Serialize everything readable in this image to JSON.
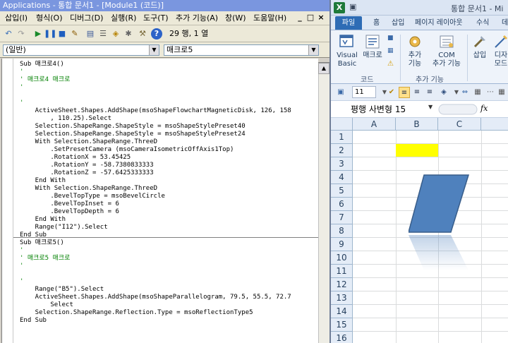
{
  "vba": {
    "title": "Applications - 통합 문서1 - [Module1 (코드)]",
    "menu": [
      {
        "label": "삽입(I)"
      },
      {
        "label": "형식(O)"
      },
      {
        "label": "디버그(D)"
      },
      {
        "label": "실행(R)"
      },
      {
        "label": "도구(T)"
      },
      {
        "label": "추가 기능(A)"
      },
      {
        "label": "창(W)"
      },
      {
        "label": "도움말(H)"
      }
    ],
    "window_controls": {
      "min": "_",
      "restore": "□",
      "close": "×"
    },
    "position": "29 행, 1 열",
    "object_combo": "(일반)",
    "proc_combo": "매크로5",
    "code_lines": [
      {
        "text": "Sub 매크로4()",
        "type": "code"
      },
      {
        "text": "'",
        "type": "comment"
      },
      {
        "text": "' 매크로4 매크로",
        "type": "comment"
      },
      {
        "text": "'",
        "type": "comment"
      },
      {
        "text": "",
        "type": "code"
      },
      {
        "text": "'",
        "type": "comment"
      },
      {
        "text": "    ActiveSheet.Shapes.AddShape(msoShapeFlowchartMagneticDisk, 126, 158",
        "type": "code"
      },
      {
        "text": "        , 110.25).Select",
        "type": "code"
      },
      {
        "text": "    Selection.ShapeRange.ShapeStyle = msoShapeStylePreset40",
        "type": "code"
      },
      {
        "text": "    Selection.ShapeRange.ShapeStyle = msoShapeStylePreset24",
        "type": "code"
      },
      {
        "text": "    With Selection.ShapeRange.ThreeD",
        "type": "code"
      },
      {
        "text": "        .SetPresetCamera (msoCameraIsometricOffAxis1Top)",
        "type": "code"
      },
      {
        "text": "        .RotationX = 53.45425",
        "type": "code"
      },
      {
        "text": "        .RotationY = -58.7380833333",
        "type": "code"
      },
      {
        "text": "        .RotationZ = -57.6425333333",
        "type": "code"
      },
      {
        "text": "    End With",
        "type": "code"
      },
      {
        "text": "    With Selection.ShapeRange.ThreeD",
        "type": "code"
      },
      {
        "text": "        .BevelTopType = msoBevelCircle",
        "type": "code"
      },
      {
        "text": "        .BevelTopInset = 6",
        "type": "code"
      },
      {
        "text": "        .BevelTopDepth = 6",
        "type": "code"
      },
      {
        "text": "    End With",
        "type": "code"
      },
      {
        "text": "    Range(\"I12\").Select",
        "type": "code"
      },
      {
        "text": "End Sub",
        "type": "code"
      },
      {
        "text": "Sub 매크로5()",
        "type": "code"
      },
      {
        "text": "'",
        "type": "comment"
      },
      {
        "text": "' 매크로5 매크로",
        "type": "comment"
      },
      {
        "text": "'",
        "type": "comment"
      },
      {
        "text": "",
        "type": "code"
      },
      {
        "text": "'",
        "type": "comment"
      },
      {
        "text": "    Range(\"B5\").Select",
        "type": "code"
      },
      {
        "text": "    ActiveSheet.Shapes.AddShape(msoShapeParallelogram, 79.5, 55.5, 72.7",
        "type": "code"
      },
      {
        "text": "        Select",
        "type": "code"
      },
      {
        "text": "    Selection.ShapeRange.Reflection.Type = msoReflectionType5",
        "type": "code"
      },
      {
        "text": "End Sub",
        "type": "code"
      }
    ]
  },
  "excel": {
    "logo": "X",
    "title": "통합 문서1 - Mi",
    "tabs": [
      {
        "label": "파일"
      },
      {
        "label": "홈"
      },
      {
        "label": "삽입"
      },
      {
        "label": "페이지 레이아웃"
      },
      {
        "label": "수식"
      },
      {
        "label": "데"
      }
    ],
    "ribbon": {
      "visual_basic": "Visual\nBasic",
      "macro": "매크로",
      "group_code": "코드",
      "addins": "추가\n기능",
      "com_addins": "COM\n추가 기능",
      "group_addins": "추가 기능",
      "insert": "삽입",
      "design": "디자\n모드"
    },
    "font_size": "11",
    "font_name": "평행 사변형 15",
    "fx": "fx",
    "columns": [
      "A",
      "B",
      "C"
    ],
    "rows": [
      "1",
      "2",
      "3",
      "4",
      "5",
      "6",
      "7",
      "8",
      "9",
      "10",
      "11",
      "12",
      "13",
      "14",
      "15",
      "16"
    ],
    "highlight_cell": "B2",
    "highlight_color": "#ffff00",
    "shape": {
      "type": "parallelogram",
      "fill": "#4f81bd",
      "stroke": "#385d8a",
      "reflection": true
    }
  }
}
